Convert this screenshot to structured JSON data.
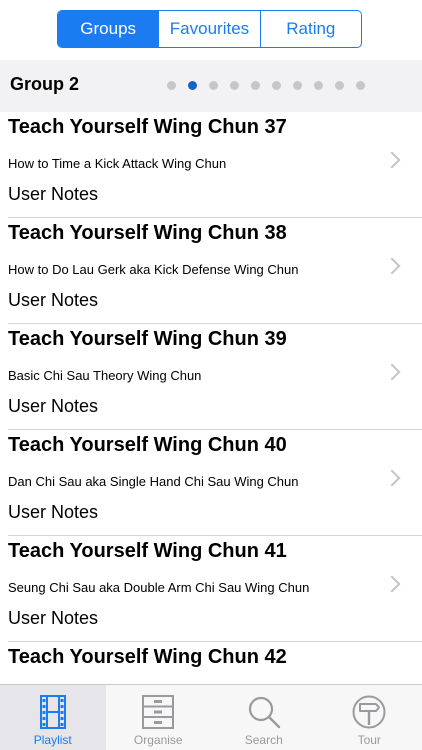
{
  "segments": {
    "groups": "Groups",
    "favourites": "Favourites",
    "rating": "Rating"
  },
  "group": {
    "title": "Group 2",
    "page_count": 10,
    "current_page": 2
  },
  "items": [
    {
      "title": "Teach Yourself Wing Chun 37",
      "subtitle": "How to Time a Kick Attack  Wing Chun",
      "notes": "User Notes"
    },
    {
      "title": "Teach Yourself Wing Chun 38",
      "subtitle": "How to Do Lau Gerk aka Kick Defense  Wing Chun",
      "notes": "User Notes"
    },
    {
      "title": "Teach Yourself Wing Chun 39",
      "subtitle": "Basic Chi Sau Theory  Wing Chun",
      "notes": "User Notes"
    },
    {
      "title": "Teach Yourself Wing Chun 40",
      "subtitle": "Dan Chi Sau aka Single Hand Chi Sau  Wing Chun",
      "notes": "User Notes"
    },
    {
      "title": "Teach Yourself Wing Chun 41",
      "subtitle": "Seung Chi Sau aka Double Arm Chi Sau  Wing Chun",
      "notes": "User Notes"
    },
    {
      "title": "Teach Yourself Wing Chun 42"
    }
  ],
  "tabs": {
    "playlist": "Playlist",
    "organise": "Organise",
    "search": "Search",
    "tour": "Tour"
  },
  "colors": {
    "accent": "#1a7cf0",
    "inactive": "#9a9a9e"
  },
  "icons": {
    "playlist": "film-strip-icon",
    "organise": "drawer-cabinet-icon",
    "search": "magnifier-icon",
    "tour": "signpost-icon"
  }
}
